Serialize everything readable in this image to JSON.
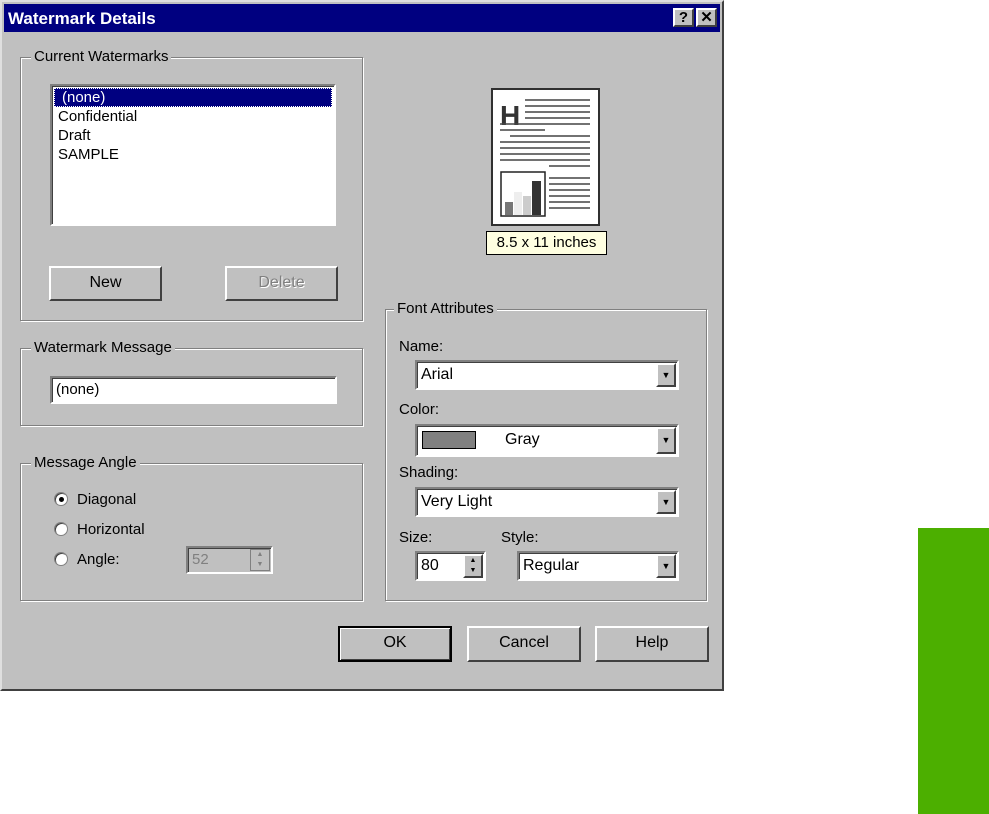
{
  "dialog": {
    "title": "Watermark Details",
    "help_btn": "?",
    "close_btn": "✕"
  },
  "current_watermarks": {
    "label": "Current Watermarks",
    "items": [
      "(none)",
      "Confidential",
      "Draft",
      "SAMPLE"
    ],
    "selected": 0,
    "new_label": "New",
    "delete_label": "Delete"
  },
  "watermark_message": {
    "label": "Watermark Message",
    "value": "(none)"
  },
  "message_angle": {
    "label": "Message Angle",
    "diagonal": "Diagonal",
    "horizontal": "Horizontal",
    "angle": "Angle:",
    "angle_value": "52",
    "selected": "diagonal"
  },
  "preview": {
    "paper_size": "8.5 x 11 inches"
  },
  "font_attributes": {
    "label": "Font Attributes",
    "name_label": "Name:",
    "name_value": "Arial",
    "color_label": "Color:",
    "color_value": "Gray",
    "color_swatch": "#808080",
    "shading_label": "Shading:",
    "shading_value": "Very Light",
    "size_label": "Size:",
    "size_value": "80",
    "style_label": "Style:",
    "style_value": "Regular"
  },
  "footer": {
    "ok": "OK",
    "cancel": "Cancel",
    "help": "Help"
  },
  "colors": {
    "title_bar": "#000080",
    "dialog_bg": "#c0c0c0",
    "page_tab": "#4caf00"
  }
}
